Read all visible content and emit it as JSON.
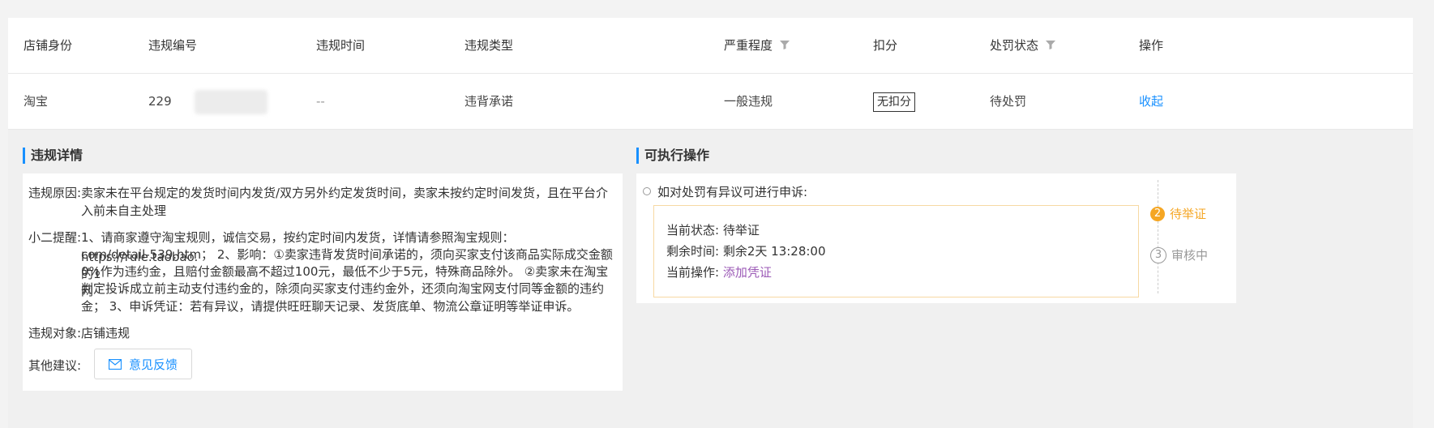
{
  "table": {
    "headers": [
      "店铺身份",
      "违规编号",
      "违规时间",
      "违规类型",
      "严重程度",
      "扣分",
      "处罚状态",
      "操作"
    ],
    "row": {
      "shop": "淘宝",
      "violation_id": "229",
      "time": "--",
      "type": "违背承诺",
      "severity": "一般违规",
      "deduction": "无扣分",
      "status": "待处罚",
      "action": "收起"
    }
  },
  "details": {
    "title": "违规详情",
    "reason_label": "违规原因:",
    "reason_line1": "卖家未在平台规定的发货时间内发货/双方另外约定发货时间，卖家未按约定时间发货，且在平台介",
    "reason_line2": "入前未自主处理",
    "reminder_label": "小二提醒:",
    "reminder_line1": "1、请商家遵守淘宝规则，诚信交易，按约定时间内发货，详情请参照淘宝规则：https://rule.taobao.",
    "reminder_line2": "com/detail-539.htm； 2、影响：①卖家违背发货时间承诺的，须向买家支付该商品实际成交金额的1",
    "reminder_line3": "0%作为违约金，且赔付金额最高不超过100元，最低不少于5元，特殊商品除外。 ②卖家未在淘宝网",
    "reminder_line4": "判定投诉成立前主动支付违约金的，除须向买家支付违约金外，还须向淘宝网支付同等金额的违约",
    "reminder_line5": "金； 3、申诉凭证：若有异议，请提供旺旺聊天记录、发货底单、物流公章证明等举证申诉。",
    "target_label": "违规对象:",
    "target_value": "店铺违规",
    "other_label": "其他建议:",
    "feedback_button": "意见反馈"
  },
  "actions": {
    "title": "可执行操作",
    "appeal_hint": "如对处罚有异议可进行申诉:",
    "current_status_label": "当前状态:",
    "current_status_value": "待举证",
    "remaining_label": "剩余时间:",
    "remaining_value": "剩余2天 13:28:00",
    "current_op_label": "当前操作:",
    "current_op_value": "添加凭证",
    "steps": [
      {
        "num": "2",
        "label": "待举证",
        "color": "#f5a623"
      },
      {
        "num": "3",
        "label": "审核中",
        "color": "#999999"
      }
    ]
  }
}
